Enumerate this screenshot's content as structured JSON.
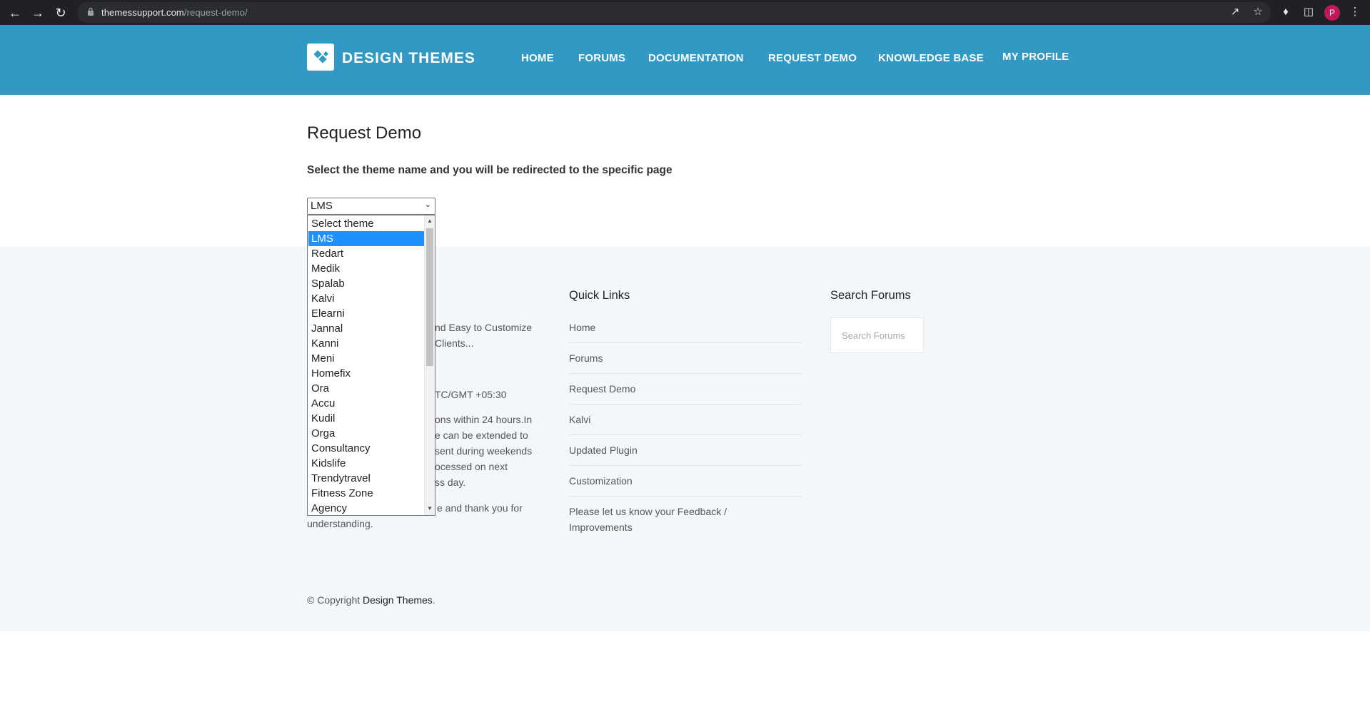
{
  "browser": {
    "url_domain": "themessupport.com",
    "url_path": "/request-demo/",
    "profile_initial": "P"
  },
  "header": {
    "logo_text": "DESIGN THEMES",
    "nav": [
      "HOME",
      "FORUMS",
      "DOCUMENTATION",
      "REQUEST DEMO",
      "KNOWLEDGE BASE",
      "MY PROFILE"
    ]
  },
  "main": {
    "title": "Request Demo",
    "instruction": "Select the theme name and you will be redirected to the specific page",
    "select_value": "LMS",
    "options": [
      "Select theme",
      "LMS",
      "Redart",
      "Medik",
      "Spalab",
      "Kalvi",
      "Elearni",
      "Jannal",
      "Kanni",
      "Meni",
      "Homefix",
      "Ora",
      "Accu",
      "Kudil",
      "Orga",
      "Consultancy",
      "Kidslife",
      "Trendytravel",
      "Fitness Zone",
      "Agency"
    ],
    "selected_index": 1
  },
  "footer": {
    "about_lines": [
      "nd Easy to Customize",
      " Clients...",
      "TC/GMT +05:30",
      "ons within 24 hours.In",
      "e can be extended to",
      "sent during weekends",
      "ocessed on next",
      "ss day.",
      "e and thank you for",
      "understanding."
    ],
    "quick_links_heading": "Quick Links",
    "quick_links": [
      "Home",
      "Forums",
      "Request Demo",
      "Kalvi",
      "Updated Plugin",
      "Customization",
      "Please let us know your Feedback / Improvements"
    ],
    "search_heading": "Search Forums",
    "search_placeholder": "Search Forums",
    "copyright_prefix": "© Copyright ",
    "copyright_brand": "Design Themes",
    "copyright_suffix": "."
  },
  "colors": {
    "header_bg": "#3199c4",
    "footer_bg": "#f4f7f9",
    "selected_option_bg": "#1e90ff"
  }
}
